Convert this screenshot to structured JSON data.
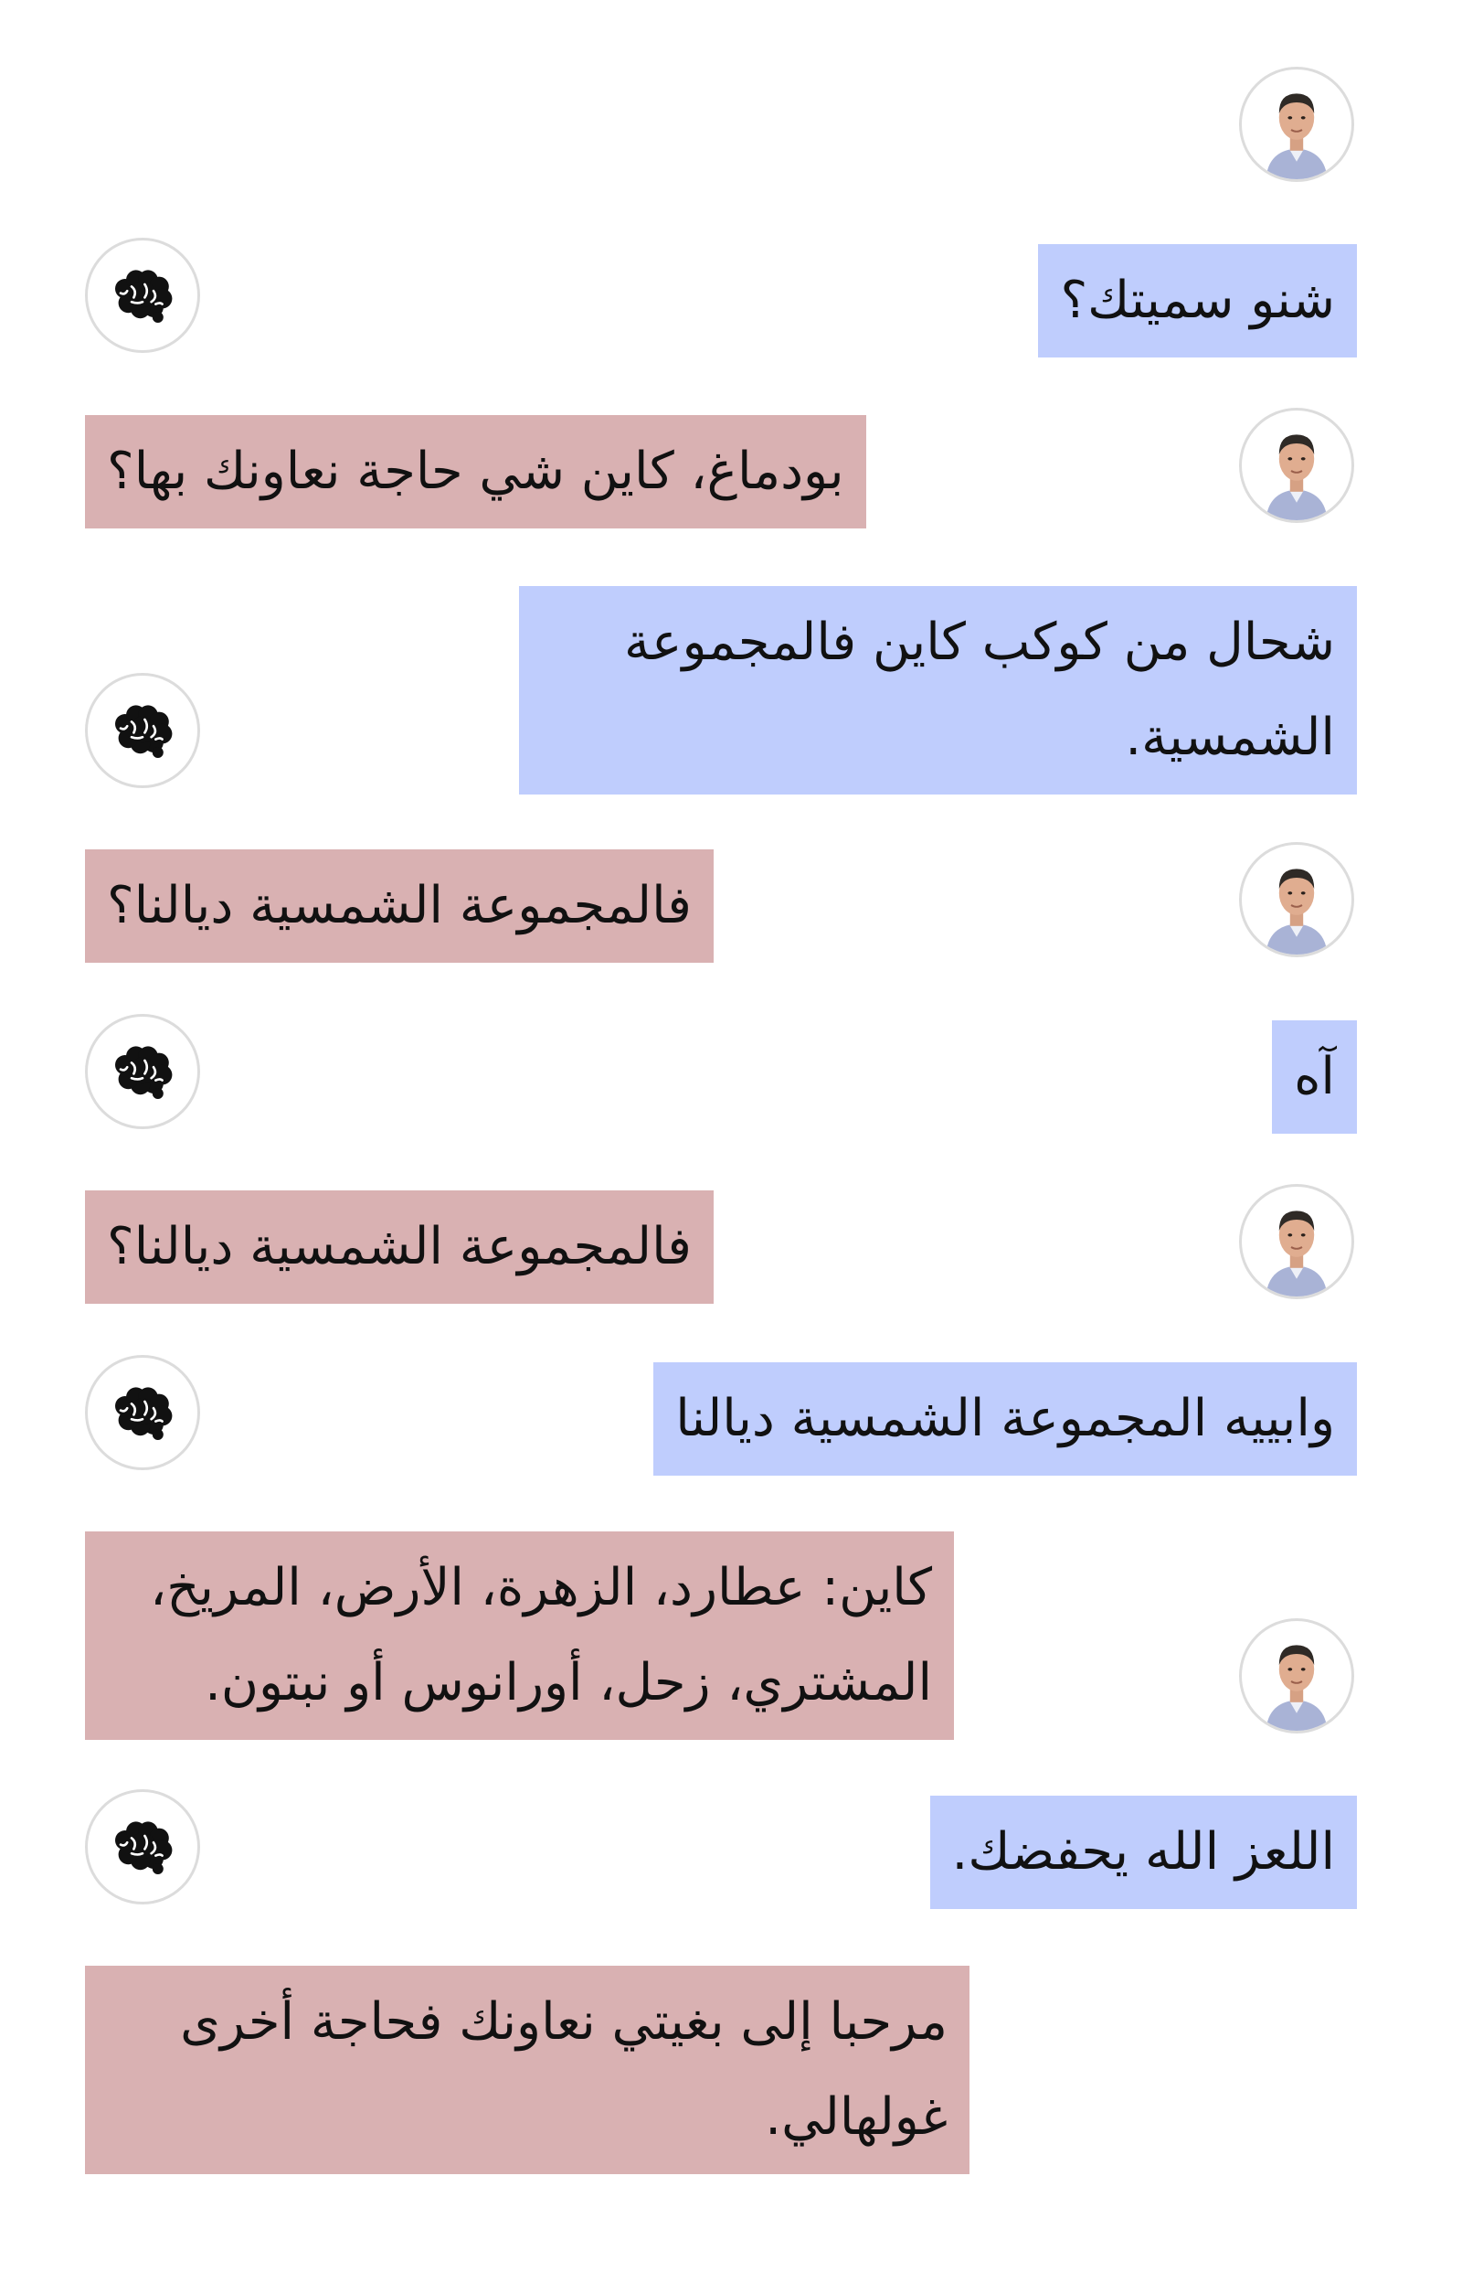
{
  "conversation": {
    "messages": [
      {
        "role": "user",
        "text": "شنو سميتك؟"
      },
      {
        "role": "bot",
        "text": "بودماغ، كاين شي حاجة نعاونك بها؟"
      },
      {
        "role": "user",
        "text": "شحال من كوكب كاين فالمجموعة الشمسية."
      },
      {
        "role": "bot",
        "text": "فالمجموعة الشمسية ديالنا؟"
      },
      {
        "role": "user",
        "text": "آه"
      },
      {
        "role": "bot",
        "text": "فالمجموعة الشمسية ديالنا؟"
      },
      {
        "role": "user",
        "text": "وابييه المجموعة الشمسية ديالنا"
      },
      {
        "role": "bot",
        "text": "كاين: عطارد، الزهرة، الأرض، المريخ، المشتري، زحل، أورانوس أو نبتون."
      },
      {
        "role": "user",
        "text": "اللعز الله يحفضك."
      },
      {
        "role": "bot",
        "text": "مرحبا إلى بغيتي نعاونك فحاجة أخرى غولهالي."
      }
    ]
  },
  "icons": {
    "user_avatar": "user-photo-avatar",
    "bot_avatar": "brain-icon"
  },
  "colors": {
    "user_bubble": "#bfcdfd",
    "bot_bubble": "#d9b1b2",
    "avatar_border": "#dcdcdc"
  }
}
